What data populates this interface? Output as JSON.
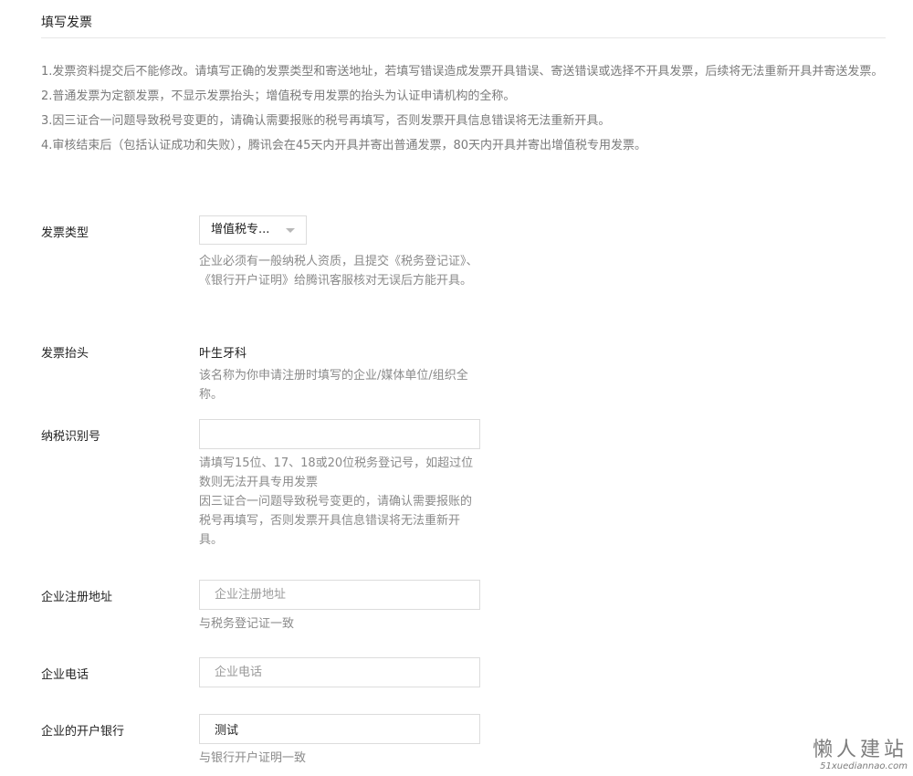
{
  "section": {
    "title": "填写发票"
  },
  "notes": [
    "1.发票资料提交后不能修改。请填写正确的发票类型和寄送地址，若填写错误造成发票开具错误、寄送错误或选择不开具发票，后续将无法重新开具并寄送发票。",
    "2.普通发票为定额发票，不显示发票抬头；增值税专用发票的抬头为认证申请机构的全称。",
    "3.因三证合一问题导致税号变更的，请确认需要报账的税号再填写，否则发票开具信息错误将无法重新开具。",
    "4.审核结束后（包括认证成功和失败），腾讯会在45天内开具并寄出普通发票，80天内开具并寄出增值税专用发票。"
  ],
  "form": {
    "invoice_type": {
      "label": "发票类型",
      "selected": "增值税专...",
      "help": "企业必须有一般纳税人资质，且提交《税务登记证》、《银行开户证明》给腾讯客服核对无误后方能开具。"
    },
    "invoice_header": {
      "label": "发票抬头",
      "value": "叶生牙科",
      "help": "该名称为你申请注册时填写的企业/媒体单位/组织全称。"
    },
    "tax_id": {
      "label": "纳税识别号",
      "value": "",
      "placeholder": "",
      "help_1": "请填写15位、17、18或20位税务登记号，如超过位数则无法开具专用发票",
      "help_2": "因三证合一问题导致税号变更的，请确认需要报账的税号再填写，否则发票开具信息错误将无法重新开具。"
    },
    "reg_address": {
      "label": "企业注册地址",
      "value": "",
      "placeholder": "企业注册地址",
      "help": "与税务登记证一致"
    },
    "phone": {
      "label": "企业电话",
      "value": "",
      "placeholder": "企业电话"
    },
    "bank": {
      "label": "企业的开户银行",
      "value": "测试",
      "placeholder": "",
      "help": "与银行开户证明一致"
    }
  },
  "watermark": {
    "main": "懒人建站",
    "sub": "51xuediannao.com"
  },
  "icons": {
    "select_caret": "chevron-down-icon"
  },
  "colors": {
    "label": "#222222",
    "helper": "#8a8a8a",
    "border": "#dcdcdc"
  }
}
